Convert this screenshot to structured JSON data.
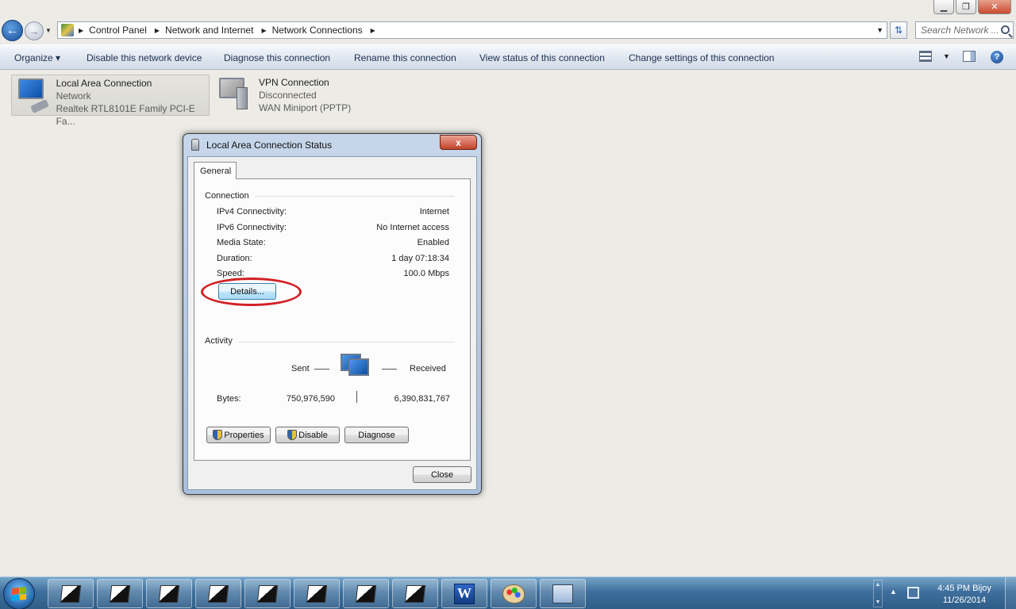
{
  "window": {
    "minimize_glyph": "▁",
    "maximize_glyph": "❐",
    "close_glyph": "✕"
  },
  "address_bar": {
    "crumbs": [
      "Control Panel",
      "Network and Internet",
      "Network Connections"
    ],
    "search_placeholder": "Search Network ..."
  },
  "command_bar": {
    "organize": "Organize ▾",
    "items": [
      "Disable this network device",
      "Diagnose this connection",
      "Rename this connection",
      "View status of this connection",
      "Change settings of this connection"
    ]
  },
  "connections": [
    {
      "name": "Local Area Connection",
      "status": "Network",
      "device": "Realtek RTL8101E Family PCI-E Fa..."
    },
    {
      "name": "VPN Connection",
      "status": "Disconnected",
      "device": "WAN Miniport (PPTP)"
    }
  ],
  "dialog": {
    "title": "Local Area Connection Status",
    "close_glyph": "x",
    "tab": "General",
    "connection_group": "Connection",
    "rows": [
      {
        "label": "IPv4 Connectivity:",
        "value": "Internet"
      },
      {
        "label": "IPv6 Connectivity:",
        "value": "No Internet access"
      },
      {
        "label": "Media State:",
        "value": "Enabled"
      },
      {
        "label": "Duration:",
        "value": "1 day 07:18:34"
      },
      {
        "label": "Speed:",
        "value": "100.0 Mbps"
      }
    ],
    "details_button": "Details...",
    "activity_group": "Activity",
    "sent_label": "Sent",
    "received_label": "Received",
    "bytes_label": "Bytes:",
    "bytes_sent": "750,976,590",
    "bytes_received": "6,390,831,767",
    "properties_button": "Properties",
    "disable_button": "Disable",
    "diagnose_button": "Diagnose",
    "close_button": "Close"
  },
  "taskbar": {
    "clock_time": "4:45 PM Bijoy",
    "clock_date": "11/26/2014",
    "word_letter": "W"
  },
  "colors": {
    "highlight_ellipse": "#d21f25",
    "taskbar": "#3e6f9c",
    "command_bar": "#dde4ee"
  }
}
